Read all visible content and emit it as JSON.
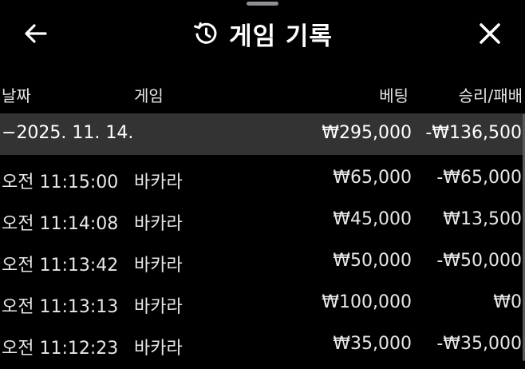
{
  "header": {
    "title": "게임 기록",
    "back_icon": "arrow-left-icon",
    "history_icon": "history-clock-icon",
    "close_icon": "close-icon"
  },
  "columns": {
    "date": "날짜",
    "game": "게임",
    "bet": "베팅",
    "result": "승리/패배"
  },
  "group": {
    "toggle": "−",
    "date": "2025. 11. 14.",
    "bet_total": "₩295,000",
    "result_total": "-₩136,500"
  },
  "rows": [
    {
      "time": "오전 11:15:00",
      "game": "바카라",
      "bet": "₩65,000",
      "result": "-₩65,000"
    },
    {
      "time": "오전 11:14:08",
      "game": "바카라",
      "bet": "₩45,000",
      "result": "₩13,500"
    },
    {
      "time": "오전 11:13:42",
      "game": "바카라",
      "bet": "₩50,000",
      "result": "-₩50,000"
    },
    {
      "time": "오전 11:13:13",
      "game": "바카라",
      "bet": "₩100,000",
      "result": "₩0"
    },
    {
      "time": "오전 11:12:23",
      "game": "바카라",
      "bet": "₩35,000",
      "result": "-₩35,000"
    }
  ],
  "colors": {
    "background": "#000000",
    "group_row": "#333333",
    "text": "#ffffff"
  }
}
